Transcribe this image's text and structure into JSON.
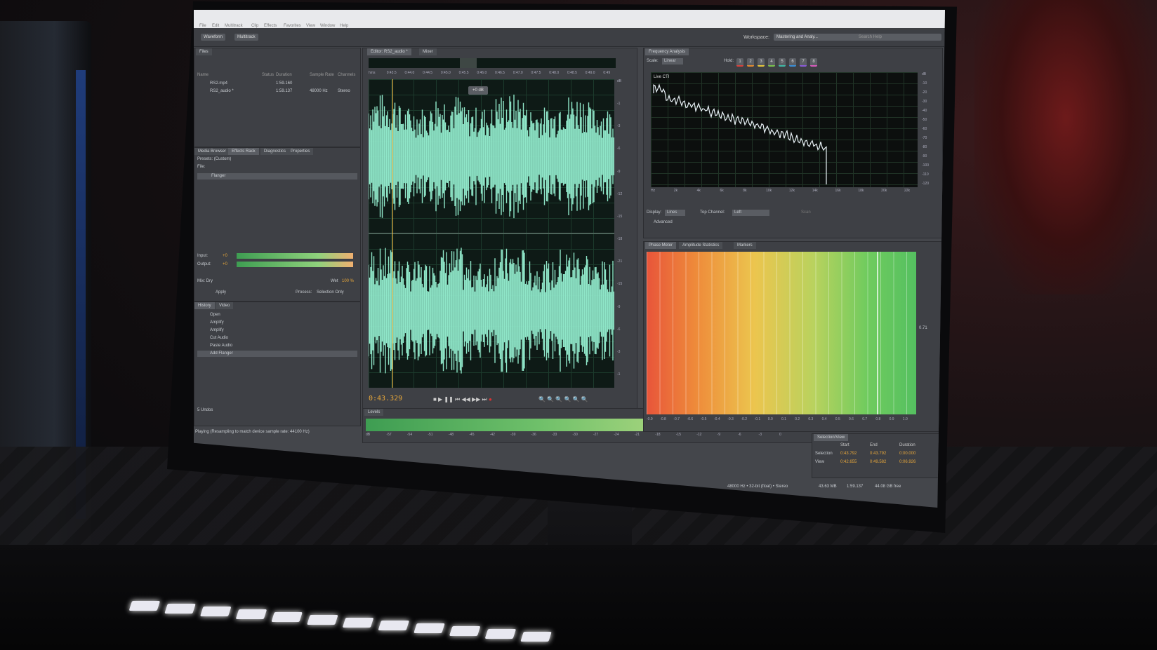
{
  "menu": [
    "File",
    "Edit",
    "Multitrack",
    "Clip",
    "Effects",
    "Favorites",
    "View",
    "Window",
    "Help"
  ],
  "mode_tabs": {
    "waveform": "Waveform",
    "multitrack": "Multitrack"
  },
  "workspace": {
    "label": "Workspace:",
    "value": "Mastering and Analy...",
    "search_placeholder": "Search Help"
  },
  "files_panel": {
    "tab": "Files",
    "columns": [
      "Name",
      "Status",
      "Duration",
      "Sample Rate",
      "Channels"
    ],
    "rows": [
      {
        "name": "RS2.mp4",
        "duration": "1:59.160",
        "rate": "",
        "channels": ""
      },
      {
        "name": "RS2_audio *",
        "duration": "1:59.137",
        "rate": "48000 Hz",
        "channels": "Stereo"
      }
    ]
  },
  "effects_panel": {
    "tabs": [
      "Media Browser",
      "Effects Rack",
      "Diagnostics",
      "Properties"
    ],
    "presets_label": "Presets:",
    "presets_value": "(Custom)",
    "file_label": "File:",
    "slots": [
      "Flanger",
      "",
      "",
      "",
      "",
      "",
      "",
      "",
      "",
      ""
    ],
    "input_label": "Input:",
    "output_label": "Output:",
    "input_value": "+0",
    "output_value": "+0",
    "mix_label": "Mix:",
    "dry": "Dry",
    "wet": "Wet",
    "wet_value": "100 %",
    "apply": "Apply",
    "process_label": "Process:",
    "process_value": "Selection Only",
    "meter_ticks": [
      "dB",
      "-54",
      "-48",
      "-42",
      "-36",
      "-30",
      "-24",
      "-18",
      "-12",
      "-6",
      "0"
    ]
  },
  "history_panel": {
    "tabs": [
      "History",
      "Video"
    ],
    "items": [
      "Open",
      "Amplify",
      "Amplify",
      "Cut Audio",
      "Paste Audio",
      "Add Flanger"
    ],
    "undo_count": "5 Undos"
  },
  "status_bar": "Playing (Resampling to match device sample rate: 44100 Hz)",
  "editor": {
    "tabs": [
      "Editor: RS2_audio *",
      "Mixer"
    ],
    "ruler": [
      "hms",
      "0:43.5",
      "0:44.0",
      "0:44.5",
      "0:45.0",
      "0:45.5",
      "0:46.0",
      "0:46.5",
      "0:47.0",
      "0:47.5",
      "0:48.0",
      "0:48.5",
      "0:49.0",
      "0:49"
    ],
    "db_scale": [
      "dB",
      "-1",
      "-3",
      "-6",
      "-9",
      "-12",
      "-15",
      "-18",
      "-21",
      "-15",
      "-9",
      "-6",
      "-3",
      "-1"
    ],
    "hud_gain": "+0 dB",
    "time": "0:43.329",
    "channel_labels": [
      "L",
      "R"
    ]
  },
  "levels_panel": {
    "tab": "Levels",
    "ticks": [
      "dB",
      "-57",
      "-54",
      "-51",
      "-48",
      "-45",
      "-42",
      "-39",
      "-36",
      "-33",
      "-30",
      "-27",
      "-24",
      "-21",
      "-18",
      "-15",
      "-12",
      "-9",
      "-6",
      "-3",
      "0"
    ],
    "level_fraction": 0.9
  },
  "frequency_panel": {
    "tab": "Frequency Analysis",
    "scale_label": "Scale:",
    "scale_value": "Linear",
    "hold_label": "Hold:",
    "holds": [
      "1",
      "2",
      "3",
      "4",
      "5",
      "6",
      "7",
      "8"
    ],
    "hold_colors": [
      "#d9413b",
      "#e58a2e",
      "#e6c53a",
      "#7bc24d",
      "#3fb9a6",
      "#3a8fd9",
      "#8a5bd9",
      "#d95bbd"
    ],
    "plot_label": "Live CTI",
    "x_ticks": [
      "Hz",
      "2k",
      "4k",
      "6k",
      "8k",
      "10k",
      "12k",
      "14k",
      "16k",
      "18k",
      "20k",
      "22k"
    ],
    "y_ticks": [
      "dB",
      "-10",
      "-20",
      "-30",
      "-40",
      "-50",
      "-60",
      "-70",
      "-80",
      "-90",
      "-100",
      "-110",
      "-120"
    ],
    "display_label": "Display:",
    "display_value": "Lines",
    "top_channel_label": "Top Channel:",
    "top_channel_value": "Left",
    "scan": "Scan",
    "advanced": "Advanced"
  },
  "phase_panel": {
    "tabs": [
      "Phase Meter",
      "Amplitude Statistics",
      "Markers"
    ],
    "ticks": [
      "-0.9",
      "-0.8",
      "-0.7",
      "-0.6",
      "-0.5",
      "-0.4",
      "-0.3",
      "-0.2",
      "-0.1",
      "0.0",
      "0.1",
      "0.2",
      "0.3",
      "0.4",
      "0.5",
      "0.6",
      "0.7",
      "0.8",
      "0.9",
      "1.0"
    ],
    "value": "0.71"
  },
  "selection_panel": {
    "tab": "Selection/View",
    "headers": [
      "Start",
      "End",
      "Duration"
    ],
    "selection": {
      "label": "Selection",
      "start": "0:43.792",
      "end": "0:43.792",
      "duration": "0:00.000"
    },
    "view": {
      "label": "View",
      "start": "0:42.655",
      "end": "0:49.582",
      "duration": "0:06.926"
    }
  },
  "info_bar": {
    "format": "48000 Hz • 32-bit (float) • Stereo",
    "size": "43.63 MB",
    "duration": "1:59.137",
    "free": "44.08 GB free"
  }
}
